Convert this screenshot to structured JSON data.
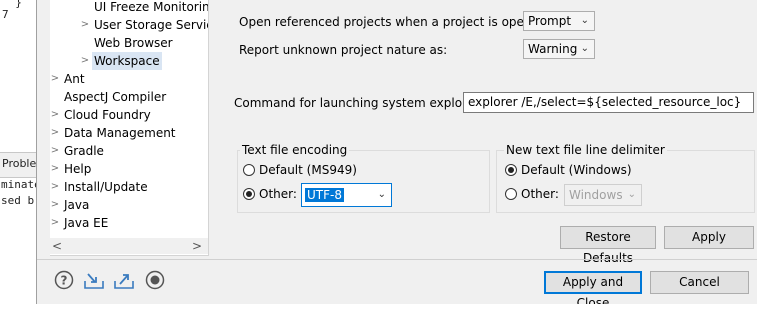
{
  "background": {
    "code_lines": [
      "  }",
      "7",
      "",
      "",
      "",
      "",
      "",
      "",
      "",
      "",
      "",
      "",
      "",
      "",
      "",
      "",
      "",
      ""
    ],
    "tab_label": "Proble",
    "console_lines": [
      "minate",
      "sed b"
    ]
  },
  "tree": {
    "items": [
      {
        "label": "UI Freeze Monitoring",
        "arrow": ""
      },
      {
        "label": "User Storage Service",
        "arrow": ">"
      },
      {
        "label": "Web Browser",
        "arrow": ""
      },
      {
        "label": "Workspace",
        "arrow": ">",
        "selected": true
      },
      {
        "label": "Ant",
        "arrow": ">"
      },
      {
        "label": "AspectJ Compiler",
        "arrow": ""
      },
      {
        "label": "Cloud Foundry",
        "arrow": ">"
      },
      {
        "label": "Data Management",
        "arrow": ">"
      },
      {
        "label": "Gradle",
        "arrow": ">"
      },
      {
        "label": "Help",
        "arrow": ">"
      },
      {
        "label": "Install/Update",
        "arrow": ">"
      },
      {
        "label": "Java",
        "arrow": ">"
      },
      {
        "label": "Java EE",
        "arrow": ">"
      }
    ],
    "scroll_left": "<",
    "scroll_right": ">",
    "scroll_down": "v"
  },
  "settings": {
    "open_projects_label": "Open referenced projects when a project is opened:",
    "open_projects_value": "Prompt",
    "unknown_nature_label": "Report unknown project nature as:",
    "unknown_nature_value": "Warning",
    "explorer_label": "Command for launching system explorer:",
    "explorer_value": "explorer /E,/select=${selected_resource_loc}"
  },
  "encoding": {
    "title": "Text file encoding",
    "default_label": "Default (MS949)",
    "other_label": "Other:",
    "other_value": "UTF-8",
    "selected": "other"
  },
  "delimiter": {
    "title": "New text file line delimiter",
    "default_label": "Default (Windows)",
    "other_label": "Other:",
    "other_value": "Windows",
    "selected": "default"
  },
  "buttons": {
    "restore_defaults": "Restore Defaults",
    "apply": "Apply",
    "apply_and_close": "Apply and Close",
    "cancel": "Cancel"
  },
  "colors": {
    "selection": "#d9e5f3",
    "accent": "#0078d7",
    "icon": "#3a7bbf"
  }
}
